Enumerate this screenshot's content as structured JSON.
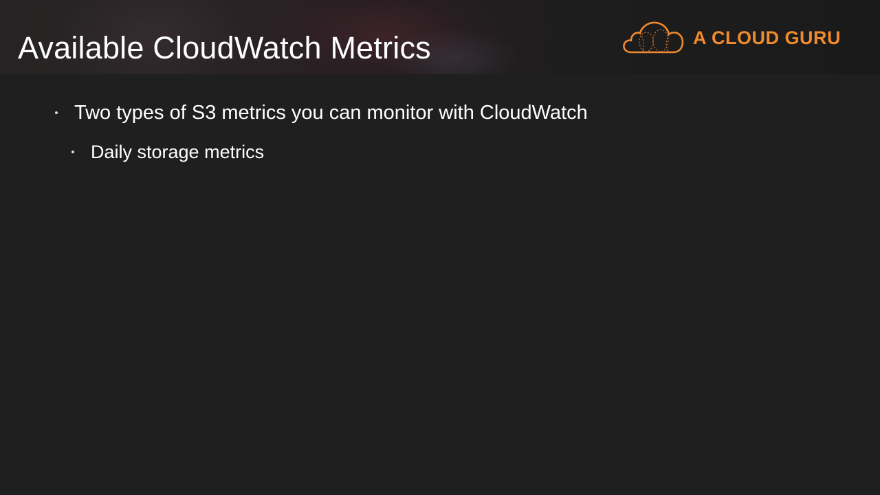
{
  "slide": {
    "title": "Available CloudWatch Metrics",
    "logo": {
      "icon": "cloud-logo-icon",
      "text": "A CLOUD GURU",
      "color": "#f08a2e"
    },
    "bullets": [
      {
        "level": 1,
        "text": "Two types of S3 metrics you can monitor with CloudWatch"
      },
      {
        "level": 2,
        "text": "Daily storage metrics"
      }
    ]
  },
  "colors": {
    "background": "#1f1f1f",
    "text": "#ffffff",
    "accent": "#f08a2e"
  }
}
